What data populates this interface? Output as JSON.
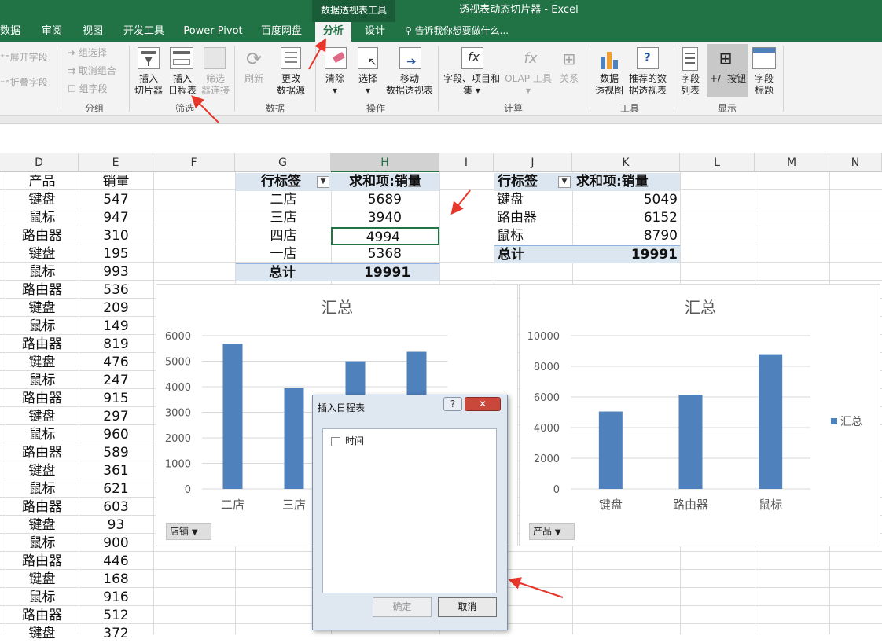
{
  "window": {
    "context_tab": "数据透视表工具",
    "title": "透视表动态切片器 - Excel"
  },
  "tabs": [
    {
      "label": "数据"
    },
    {
      "label": "审阅"
    },
    {
      "label": "视图"
    },
    {
      "label": "开发工具"
    },
    {
      "label": "Power Pivot"
    },
    {
      "label": "百度网盘"
    },
    {
      "label": "分析"
    },
    {
      "label": "设计"
    }
  ],
  "tell_me": "告诉我你想要做什么...",
  "ribbon": {
    "expand_field": "展开字段",
    "collapse_field": "折叠字段",
    "group_selection": "组选择",
    "ungroup": "取消组合",
    "group_field": "组字段",
    "group_label": "分组",
    "insert_slicer_1": "插入",
    "insert_slicer_2": "切片器",
    "insert_timeline_1": "插入",
    "insert_timeline_2": "日程表",
    "filter_conn_1": "筛选",
    "filter_conn_2": "器连接",
    "filter_label": "筛选",
    "refresh": "刷新",
    "change_source_1": "更改",
    "change_source_2": "数据源",
    "data_label": "数据",
    "clear": "清除",
    "select": "选择",
    "move_pivot_1": "移动",
    "move_pivot_2": "数据透视表",
    "actions_label": "操作",
    "fields_items_1": "字段、项目和",
    "fields_items_2": "集",
    "olap_tools": "OLAP 工具",
    "relationships": "关系",
    "calc_label": "计算",
    "pivot_chart_1": "数据",
    "pivot_chart_2": "透视图",
    "recommended_1": "推荐的数",
    "recommended_2": "据透视表",
    "tools_label": "工具",
    "field_list_1": "字段",
    "field_list_2": "列表",
    "plus_minus": "+/- 按钮",
    "field_headers_1": "字段",
    "field_headers_2": "标题",
    "show_label": "显示"
  },
  "columns": [
    "D",
    "E",
    "F",
    "G",
    "H",
    "I",
    "J",
    "K",
    "L",
    "M",
    "N"
  ],
  "sheet": {
    "header_product": "产品",
    "header_sales": "销量",
    "rows": [
      [
        "键盘",
        "547"
      ],
      [
        "鼠标",
        "947"
      ],
      [
        "路由器",
        "310"
      ],
      [
        "键盘",
        "195"
      ],
      [
        "鼠标",
        "993"
      ],
      [
        "路由器",
        "536"
      ],
      [
        "键盘",
        "209"
      ],
      [
        "鼠标",
        "149"
      ],
      [
        "路由器",
        "819"
      ],
      [
        "键盘",
        "476"
      ],
      [
        "鼠标",
        "247"
      ],
      [
        "路由器",
        "915"
      ],
      [
        "键盘",
        "297"
      ],
      [
        "鼠标",
        "960"
      ],
      [
        "路由器",
        "589"
      ],
      [
        "键盘",
        "361"
      ],
      [
        "鼠标",
        "621"
      ],
      [
        "路由器",
        "603"
      ],
      [
        "键盘",
        "93"
      ],
      [
        "鼠标",
        "900"
      ],
      [
        "路由器",
        "446"
      ],
      [
        "键盘",
        "168"
      ],
      [
        "鼠标",
        "916"
      ],
      [
        "路由器",
        "512"
      ],
      [
        "键盘",
        "372"
      ]
    ]
  },
  "pivot1": {
    "row_label": "行标签",
    "value_label": "求和项:销量",
    "rows": [
      [
        "二店",
        "5689"
      ],
      [
        "三店",
        "3940"
      ],
      [
        "四店",
        "4994"
      ],
      [
        "一店",
        "5368"
      ]
    ],
    "total_label": "总计",
    "total": "19991"
  },
  "pivot2": {
    "row_label": "行标签",
    "value_label": "求和项:销量",
    "rows": [
      [
        "键盘",
        "5049"
      ],
      [
        "路由器",
        "6152"
      ],
      [
        "鼠标",
        "8790"
      ]
    ],
    "total_label": "总计",
    "total": "19991"
  },
  "chart1_field": "店铺",
  "chart2_field": "产品",
  "chart2_legend": "汇总",
  "chart_data": [
    {
      "type": "bar",
      "title": "汇总",
      "categories": [
        "二店",
        "三店",
        "四店",
        "一店"
      ],
      "values": [
        5689,
        3940,
        4994,
        5368
      ],
      "ylim": [
        0,
        6000
      ],
      "yticks": [
        0,
        1000,
        2000,
        3000,
        4000,
        5000,
        6000
      ],
      "color": "#4f81bd",
      "grid": true
    },
    {
      "type": "bar",
      "title": "汇总",
      "categories": [
        "键盘",
        "路由器",
        "鼠标"
      ],
      "series": [
        {
          "name": "汇总",
          "values": [
            5049,
            6152,
            8790
          ]
        }
      ],
      "ylim": [
        0,
        10000
      ],
      "yticks": [
        0,
        2000,
        4000,
        6000,
        8000,
        10000
      ],
      "color": "#4f81bd",
      "grid": true,
      "legend": "right"
    }
  ],
  "dialog": {
    "title": "插入日程表",
    "help": "?",
    "close": "✕",
    "field": "时间",
    "ok": "确定",
    "cancel": "取消"
  }
}
